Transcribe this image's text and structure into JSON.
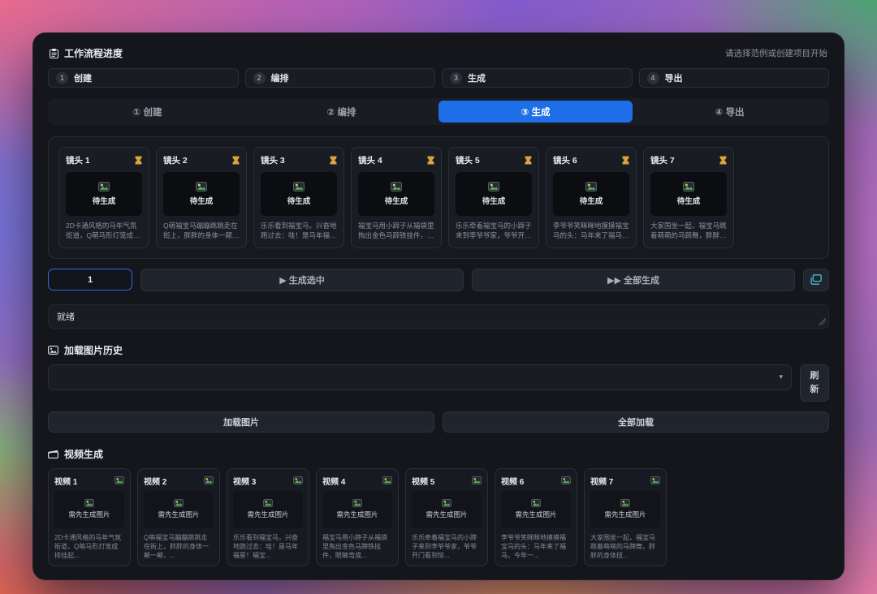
{
  "header": {
    "title": "工作流程进度",
    "hint": "请选择范例或创建项目开始"
  },
  "steps": [
    {
      "num": "1",
      "label": "创建"
    },
    {
      "num": "2",
      "label": "编排"
    },
    {
      "num": "3",
      "label": "生成"
    },
    {
      "num": "4",
      "label": "导出"
    }
  ],
  "tabs": [
    {
      "label": "① 创建",
      "active": false
    },
    {
      "label": "② 编排",
      "active": false
    },
    {
      "label": "③ 生成",
      "active": true
    },
    {
      "label": "④ 导出",
      "active": false
    }
  ],
  "shots": [
    {
      "title": "镜头 1",
      "status": "待生成",
      "desc": "2D卡通风格的马年气氛街道，Q萌马形灯笼成排挂起，红..."
    },
    {
      "title": "镜头 2",
      "status": "待生成",
      "desc": "Q萌福宝马蹦蹦跳跳走在街上，胖胖的身体一颠一颠，..."
    },
    {
      "title": "镜头 3",
      "status": "待生成",
      "desc": "乐乐看到福宝马，兴奋地跑过去：哇！是马年福星！福宝..."
    },
    {
      "title": "镜头 4",
      "status": "待生成",
      "desc": "福宝马用小蹄子从福袋里掏出金色马蹄铁挂件，眼睛弯成..."
    },
    {
      "title": "镜头 5",
      "status": "待生成",
      "desc": "乐乐牵着福宝马的小蹄子来到李爷爷家，爷爷开门看到惊..."
    },
    {
      "title": "镜头 6",
      "status": "待生成",
      "desc": "李爷爷笑眯眯地摸摸福宝马的头：马年来了福马，今年一..."
    },
    {
      "title": "镜头 7",
      "status": "待生成",
      "desc": "大家围坐一起，福宝马跳着萌萌的马蹄舞，胖胖的身体扭..."
    }
  ],
  "controls": {
    "selected": "1",
    "generate_selected": "▶ 生成选中",
    "generate_all": "▶▶ 全部生成"
  },
  "status": {
    "text": "就绪"
  },
  "image_history": {
    "title": "加载图片历史",
    "dropdown_value": "",
    "refresh": "刷新",
    "load_images": "加载图片",
    "load_all": "全部加载"
  },
  "videos": {
    "title": "视频生成",
    "items": [
      {
        "title": "视频 1",
        "status": "需先生成图片",
        "desc": "2D卡通风格的马年气氛街道，Q萌马形灯笼成排挂起..."
      },
      {
        "title": "视频 2",
        "status": "需先生成图片",
        "desc": "Q萌福宝马蹦蹦跳跳走在街上，胖胖的身体一颠一颠，..."
      },
      {
        "title": "视频 3",
        "status": "需先生成图片",
        "desc": "乐乐看到福宝马，兴奋地跑过去：哇！是马年福星！福宝..."
      },
      {
        "title": "视频 4",
        "status": "需先生成图片",
        "desc": "福宝马用小蹄子从福袋里掏出金色马蹄铁挂件，眼睛弯成..."
      },
      {
        "title": "视频 5",
        "status": "需先生成图片",
        "desc": "乐乐牵着福宝马的小蹄子来到李爷爷家，爷爷开门看到惊..."
      },
      {
        "title": "视频 6",
        "status": "需先生成图片",
        "desc": "李爷爷笑眯眯地摸摸福宝马的头：马年来了福马，今年一..."
      },
      {
        "title": "视频 7",
        "status": "需先生成图片",
        "desc": "大家围坐一起，福宝马跳着萌萌的马蹄舞，胖胖的身体扭..."
      }
    ]
  },
  "colors": {
    "accent_blue": "#1e6ee8",
    "amber": "#d7a43e",
    "teal": "#49bdd3",
    "green": "#58b35e",
    "panel_bg": "#14161c"
  }
}
